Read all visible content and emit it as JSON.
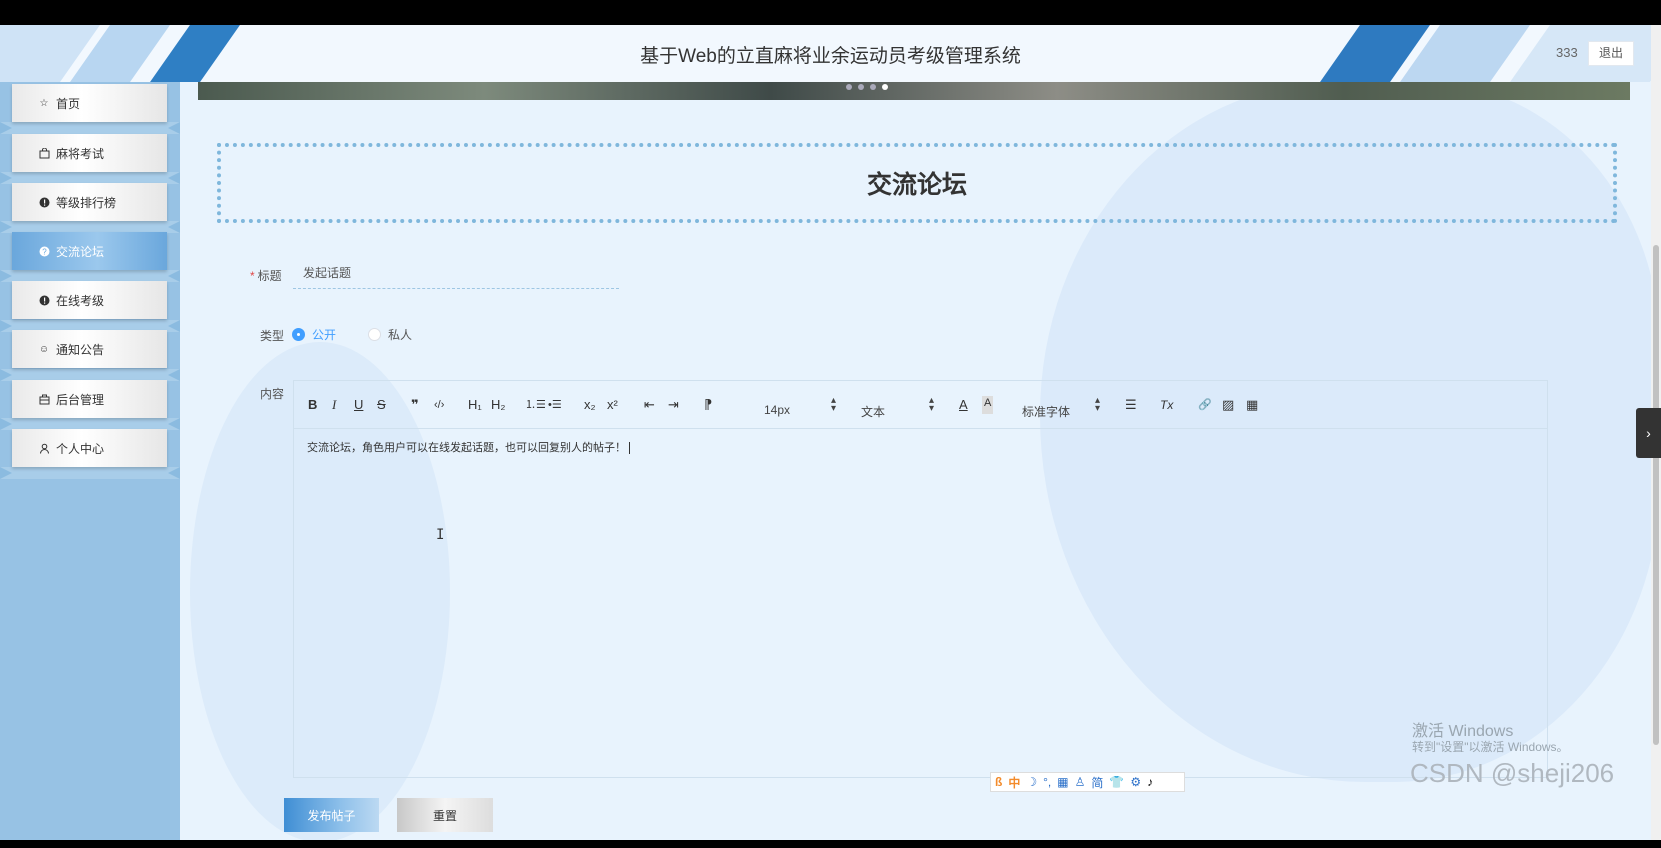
{
  "header": {
    "title": "基于Web的立直麻将业余运动员考级管理系统",
    "username": "333",
    "logout_label": "退出"
  },
  "sidebar": {
    "items": [
      {
        "label": "首页",
        "icon": "star-icon",
        "glyph": "☆"
      },
      {
        "label": "麻将考试",
        "icon": "bag-icon",
        "glyph": "🛍"
      },
      {
        "label": "等级排行榜",
        "icon": "info-circle-icon",
        "glyph": "!"
      },
      {
        "label": "交流论坛",
        "icon": "question-circle-icon",
        "glyph": "?"
      },
      {
        "label": "在线考级",
        "icon": "info-circle-icon",
        "glyph": "!"
      },
      {
        "label": "通知公告",
        "icon": "smile-icon",
        "glyph": "☺"
      },
      {
        "label": "后台管理",
        "icon": "briefcase-icon",
        "glyph": "▣"
      },
      {
        "label": "个人中心",
        "icon": "user-icon",
        "glyph": "♙"
      }
    ],
    "active_index": 3
  },
  "section": {
    "title": "交流论坛"
  },
  "form": {
    "title_label": "标题",
    "title_value": "发起话题",
    "type_label": "类型",
    "type_options": [
      "公开",
      "私人"
    ],
    "type_selected": "公开",
    "content_label": "内容",
    "content_text": "交流论坛，角色用户可以在线发起话题，也可以回复别人的帖子！",
    "submit_label": "发布帖子",
    "reset_label": "重置"
  },
  "editor_toolbar": {
    "bold": "B",
    "italic": "I",
    "underline": "U",
    "strike": "S",
    "quote": "❞",
    "code": "‹/›",
    "h1": "H₁",
    "h2": "H₂",
    "ordered_list": "⒈☰",
    "bullet_list": "•☰",
    "subscript": "x₂",
    "superscript": "x²",
    "outdent": "⇤",
    "indent": "⇥",
    "direction": "⁋",
    "font_size": "14px",
    "header_select": "文本",
    "font_family": "标准字体",
    "color_letter": "A",
    "bg_letter": "A",
    "align": "☰",
    "clean": "Tx",
    "link": "🔗",
    "image": "▨",
    "video": "▦"
  },
  "watermark": {
    "line1": "激活 Windows",
    "line2": "转到\"设置\"以激活 Windows。",
    "csdn": "CSDN @sheji206"
  },
  "ime": {
    "items": [
      "ß",
      "中",
      "☽",
      "°,",
      "▦",
      "♙",
      "简",
      "👕",
      "⚙",
      "♪"
    ]
  }
}
